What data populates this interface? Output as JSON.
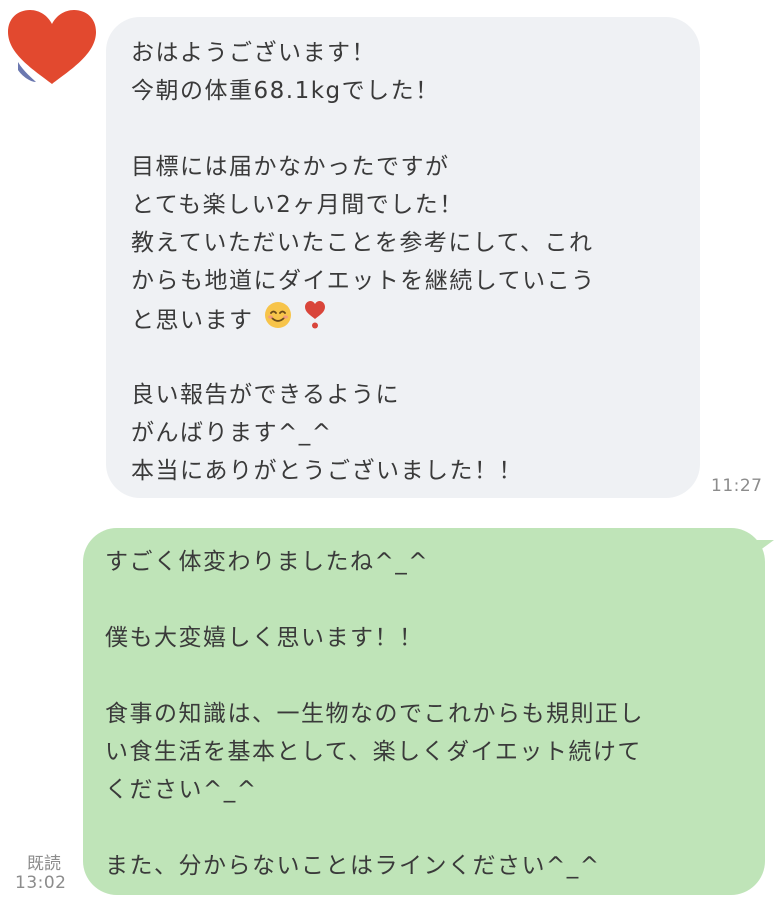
{
  "incoming_message": {
    "lines": [
      "おはようございます！",
      "今朝の体重68.1kgでした！",
      "",
      "目標には届かなかったですが",
      "とても楽しい2ヶ月間でした！",
      "教えていただいたことを参考にして、これ",
      "からも地道にダイエットを継続していこう",
      "と思います",
      "",
      "良い報告ができるように",
      "がんばります^_^",
      "本当にありがとうございました！！"
    ],
    "emojis": [
      "smiling-face-icon",
      "heart-exclamation-icon"
    ],
    "time": "11:27"
  },
  "outgoing_message": {
    "lines": [
      "すごく体変わりましたね^_^",
      "",
      "僕も大変嬉しく思います！！",
      "",
      "食事の知識は、一生物なのでこれからも規則正し",
      "い食生活を基本として、楽しくダイエット続けて",
      "ください^_^",
      "",
      "また、分からないことはラインください^_^"
    ],
    "read_status": "既読",
    "time": "13:02"
  },
  "colors": {
    "incoming_bubble": "#eff1f4",
    "outgoing_bubble": "#bfe4b8",
    "avatar": "#e2492f",
    "timestamp": "#8c8c8c"
  }
}
